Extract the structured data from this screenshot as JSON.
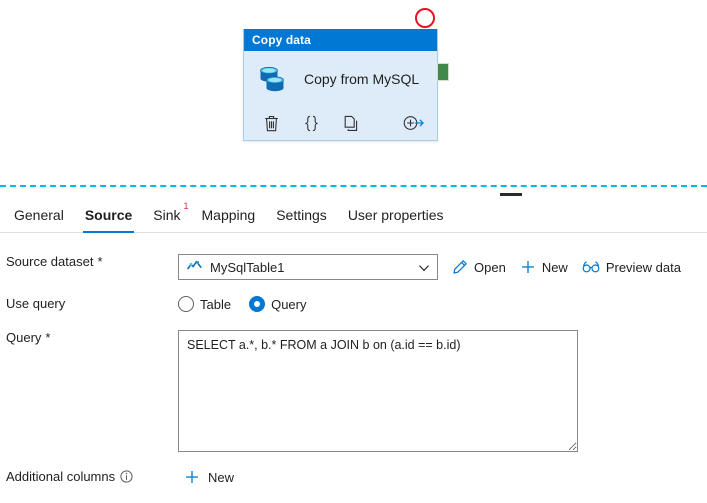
{
  "canvas": {
    "activity": {
      "header_title": "Copy data",
      "name": "Copy from MySQL",
      "icon": "database-copy-icon",
      "status_marker": "error-circle-marker",
      "output_port": "success-output-port",
      "toolbar": [
        {
          "name": "delete-activity-button",
          "icon": "trash-icon"
        },
        {
          "name": "code-view-button",
          "icon": "code-braces-icon"
        },
        {
          "name": "clone-activity-button",
          "icon": "copy-icon"
        },
        {
          "name": "add-output-button",
          "icon": "add-arrow-icon"
        }
      ]
    }
  },
  "splitter": {
    "grip": "panel-resize-grip"
  },
  "panel": {
    "tabs": [
      {
        "label": "General",
        "active": false,
        "badge": ""
      },
      {
        "label": "Source",
        "active": true,
        "badge": ""
      },
      {
        "label": "Sink",
        "active": false,
        "badge": "1"
      },
      {
        "label": "Mapping",
        "active": false,
        "badge": ""
      },
      {
        "label": "Settings",
        "active": false,
        "badge": ""
      },
      {
        "label": "User properties",
        "active": false,
        "badge": ""
      }
    ],
    "source": {
      "dataset": {
        "label": "Source dataset",
        "required_marker": "*",
        "value": "MySqlTable1",
        "icon": "dataset-icon",
        "actions": [
          {
            "label": "Open",
            "icon": "pencil-icon"
          },
          {
            "label": "New",
            "icon": "plus-icon"
          },
          {
            "label": "Preview data",
            "icon": "glasses-icon"
          }
        ]
      },
      "use_query": {
        "label": "Use query",
        "options": [
          {
            "label": "Table",
            "checked": false
          },
          {
            "label": "Query",
            "checked": true
          }
        ]
      },
      "query": {
        "label": "Query",
        "required_marker": "*",
        "value": "SELECT a.*, b.* FROM a JOIN b on (a.id == b.id)",
        "placeholder": ""
      },
      "additional_columns": {
        "label": "Additional columns",
        "info_icon": "info-icon",
        "new_label": "New"
      }
    }
  },
  "colors": {
    "accent": "#0078d4",
    "node_body": "#deecf9",
    "node_border": "#a6cdea",
    "error": "#e81123",
    "badge": "#d13438",
    "success_port": "#3f8a4b",
    "splitter": "#00b7f0"
  }
}
